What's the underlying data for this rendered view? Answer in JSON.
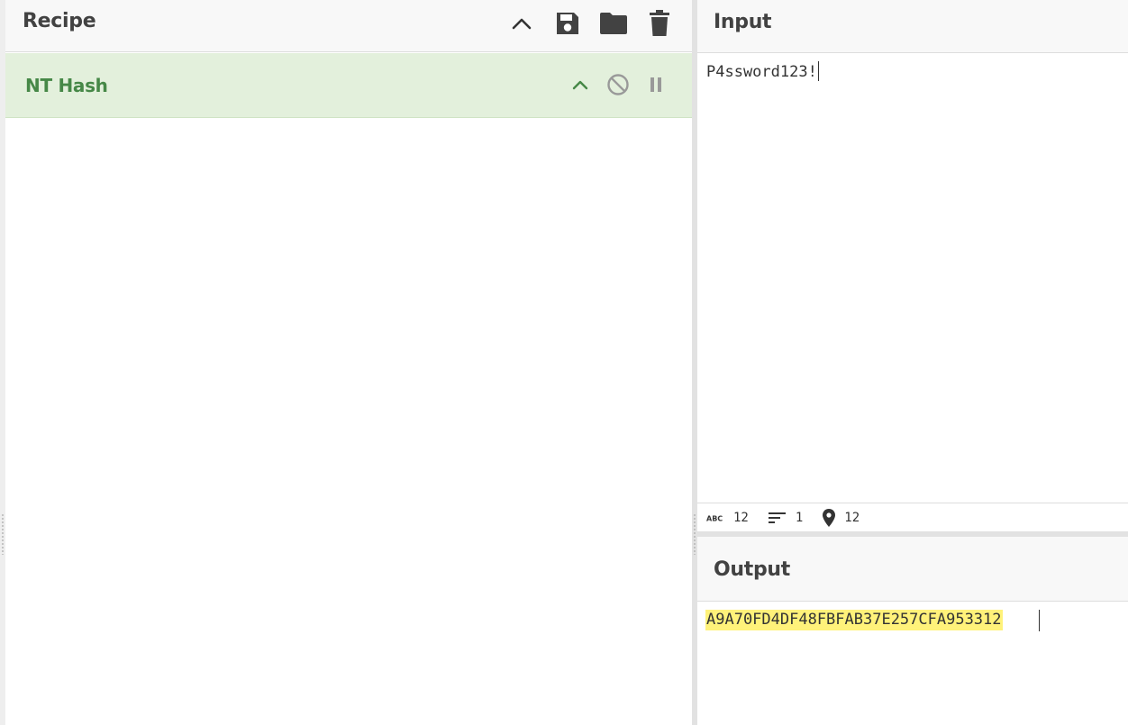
{
  "recipe": {
    "title": "Recipe",
    "header_icons": [
      "chevron-up-icon",
      "save-icon",
      "folder-icon",
      "trash-icon"
    ],
    "operation": {
      "name": "NT Hash",
      "controls": [
        "chevron-up-icon",
        "disable-icon",
        "pause-icon"
      ],
      "color": "#468847",
      "background": "#e3f0dc"
    }
  },
  "input": {
    "title": "Input",
    "text": "P4ssword123!",
    "status": {
      "length": "12",
      "lines": "1",
      "position": "12"
    }
  },
  "output": {
    "title": "Output",
    "text": "A9A70FD4DF48FBFAB37E257CFA953312",
    "highlight_color": "#fff27a"
  }
}
